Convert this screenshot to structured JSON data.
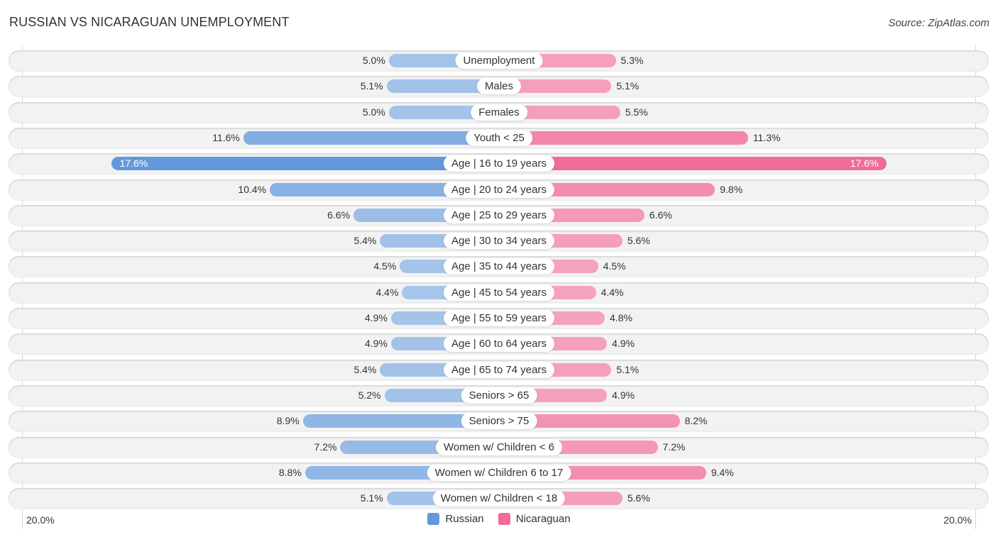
{
  "header": {
    "title": "RUSSIAN VS NICARAGUAN UNEMPLOYMENT",
    "source": "Source: ZipAtlas.com"
  },
  "colors": {
    "russian_light": "#a8c6ea",
    "russian_strong": "#6399db",
    "nicaraguan_light": "#f5a5be",
    "nicaraguan_strong": "#f06c96"
  },
  "chart_data": {
    "type": "bar",
    "orientation": "horizontal-diverging",
    "title": "RUSSIAN VS NICARAGUAN UNEMPLOYMENT",
    "categories": [
      "Unemployment",
      "Males",
      "Females",
      "Youth < 25",
      "Age | 16 to 19 years",
      "Age | 20 to 24 years",
      "Age | 25 to 29 years",
      "Age | 30 to 34 years",
      "Age | 35 to 44 years",
      "Age | 45 to 54 years",
      "Age | 55 to 59 years",
      "Age | 60 to 64 years",
      "Age | 65 to 74 years",
      "Seniors > 65",
      "Seniors > 75",
      "Women w/ Children < 6",
      "Women w/ Children 6 to 17",
      "Women w/ Children < 18"
    ],
    "series": [
      {
        "name": "Russian",
        "side": "left",
        "values": [
          5.0,
          5.1,
          5.0,
          11.6,
          17.6,
          10.4,
          6.6,
          5.4,
          4.5,
          4.4,
          4.9,
          4.9,
          5.4,
          5.2,
          8.9,
          7.2,
          8.8,
          5.1
        ],
        "labels": [
          "5.0%",
          "5.1%",
          "5.0%",
          "11.6%",
          "17.6%",
          "10.4%",
          "6.6%",
          "5.4%",
          "4.5%",
          "4.4%",
          "4.9%",
          "4.9%",
          "5.4%",
          "5.2%",
          "8.9%",
          "7.2%",
          "8.8%",
          "5.1%"
        ]
      },
      {
        "name": "Nicaraguan",
        "side": "right",
        "values": [
          5.3,
          5.1,
          5.5,
          11.3,
          17.6,
          9.8,
          6.6,
          5.6,
          4.5,
          4.4,
          4.8,
          4.9,
          5.1,
          4.9,
          8.2,
          7.2,
          9.4,
          5.6
        ],
        "labels": [
          "5.3%",
          "5.1%",
          "5.5%",
          "11.3%",
          "17.6%",
          "9.8%",
          "6.6%",
          "5.6%",
          "4.5%",
          "4.4%",
          "4.8%",
          "4.9%",
          "5.1%",
          "4.9%",
          "8.2%",
          "7.2%",
          "9.4%",
          "5.6%"
        ]
      }
    ],
    "xlim": [
      -20,
      20
    ],
    "axis_labels": {
      "left": "20.0%",
      "right": "20.0%"
    },
    "legend": {
      "position": "bottom-center",
      "entries": [
        "Russian",
        "Nicaraguan"
      ]
    },
    "unit": "%"
  }
}
